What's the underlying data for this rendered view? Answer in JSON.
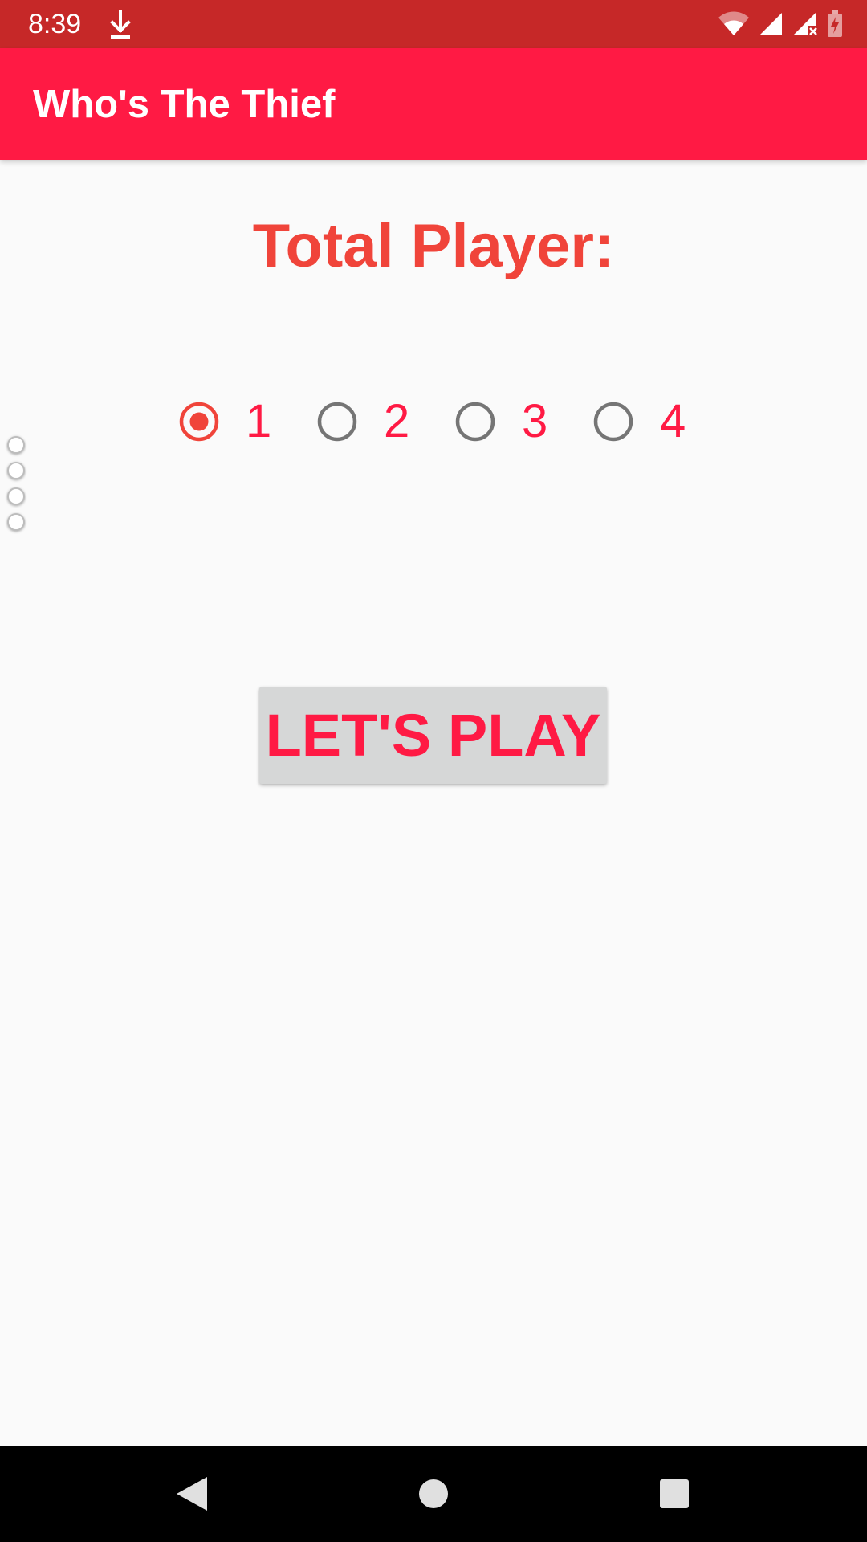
{
  "status_bar": {
    "time": "8:39",
    "icons": [
      "download-icon",
      "wifi-icon",
      "signal-icon",
      "signal-no-data-icon",
      "battery-charging-icon"
    ]
  },
  "app_bar": {
    "title": "Who's The Thief"
  },
  "main": {
    "heading": "Total Player:",
    "player_options": [
      {
        "label": "1",
        "selected": true
      },
      {
        "label": "2",
        "selected": false
      },
      {
        "label": "3",
        "selected": false
      },
      {
        "label": "4",
        "selected": false
      }
    ],
    "play_button_label": "LET'S PLAY"
  },
  "navigation": {
    "buttons": [
      "back-icon",
      "home-icon",
      "recents-icon"
    ]
  },
  "colors": {
    "status_bar": "#c62828",
    "app_bar": "#ff1a44",
    "heading": "#f0443a",
    "radio_selected": "#f0443a",
    "radio_unselected": "#757575",
    "label_accent": "#ff1a44",
    "button_bg": "#d6d7d7",
    "background": "#fafafa"
  }
}
